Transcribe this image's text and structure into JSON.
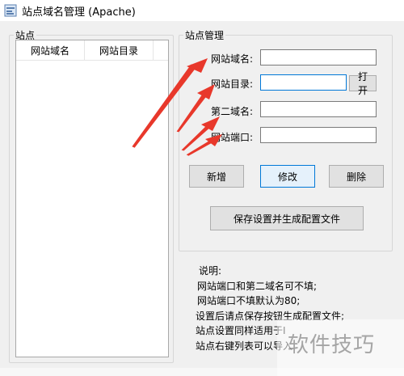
{
  "window": {
    "title": "站点域名管理 (Apache)"
  },
  "sites_group": {
    "label": "站点",
    "columns": [
      "网站域名",
      "网站目录"
    ]
  },
  "manage_group": {
    "label": "站点管理",
    "fields": {
      "domain_label": "网站域名:",
      "dir_label": "网站目录:",
      "second_domain_label": "第二域名:",
      "port_label": "网站端口:"
    },
    "buttons": {
      "open": "打开",
      "add": "新增",
      "edit": "修改",
      "delete": "删除",
      "save": "保存设置并生成配置文件"
    }
  },
  "notes": [
    "说明:",
    "网站端口和第二域名可不填;",
    "网站端口不填默认为80;",
    "设置后请点保存按钮生成配置文件;",
    "站点设置同样适用于I",
    "站点右键列表可以导入"
  ],
  "watermark": "软件技巧",
  "colors": {
    "arrow": "#e8382b",
    "focus": "#0078d7"
  }
}
